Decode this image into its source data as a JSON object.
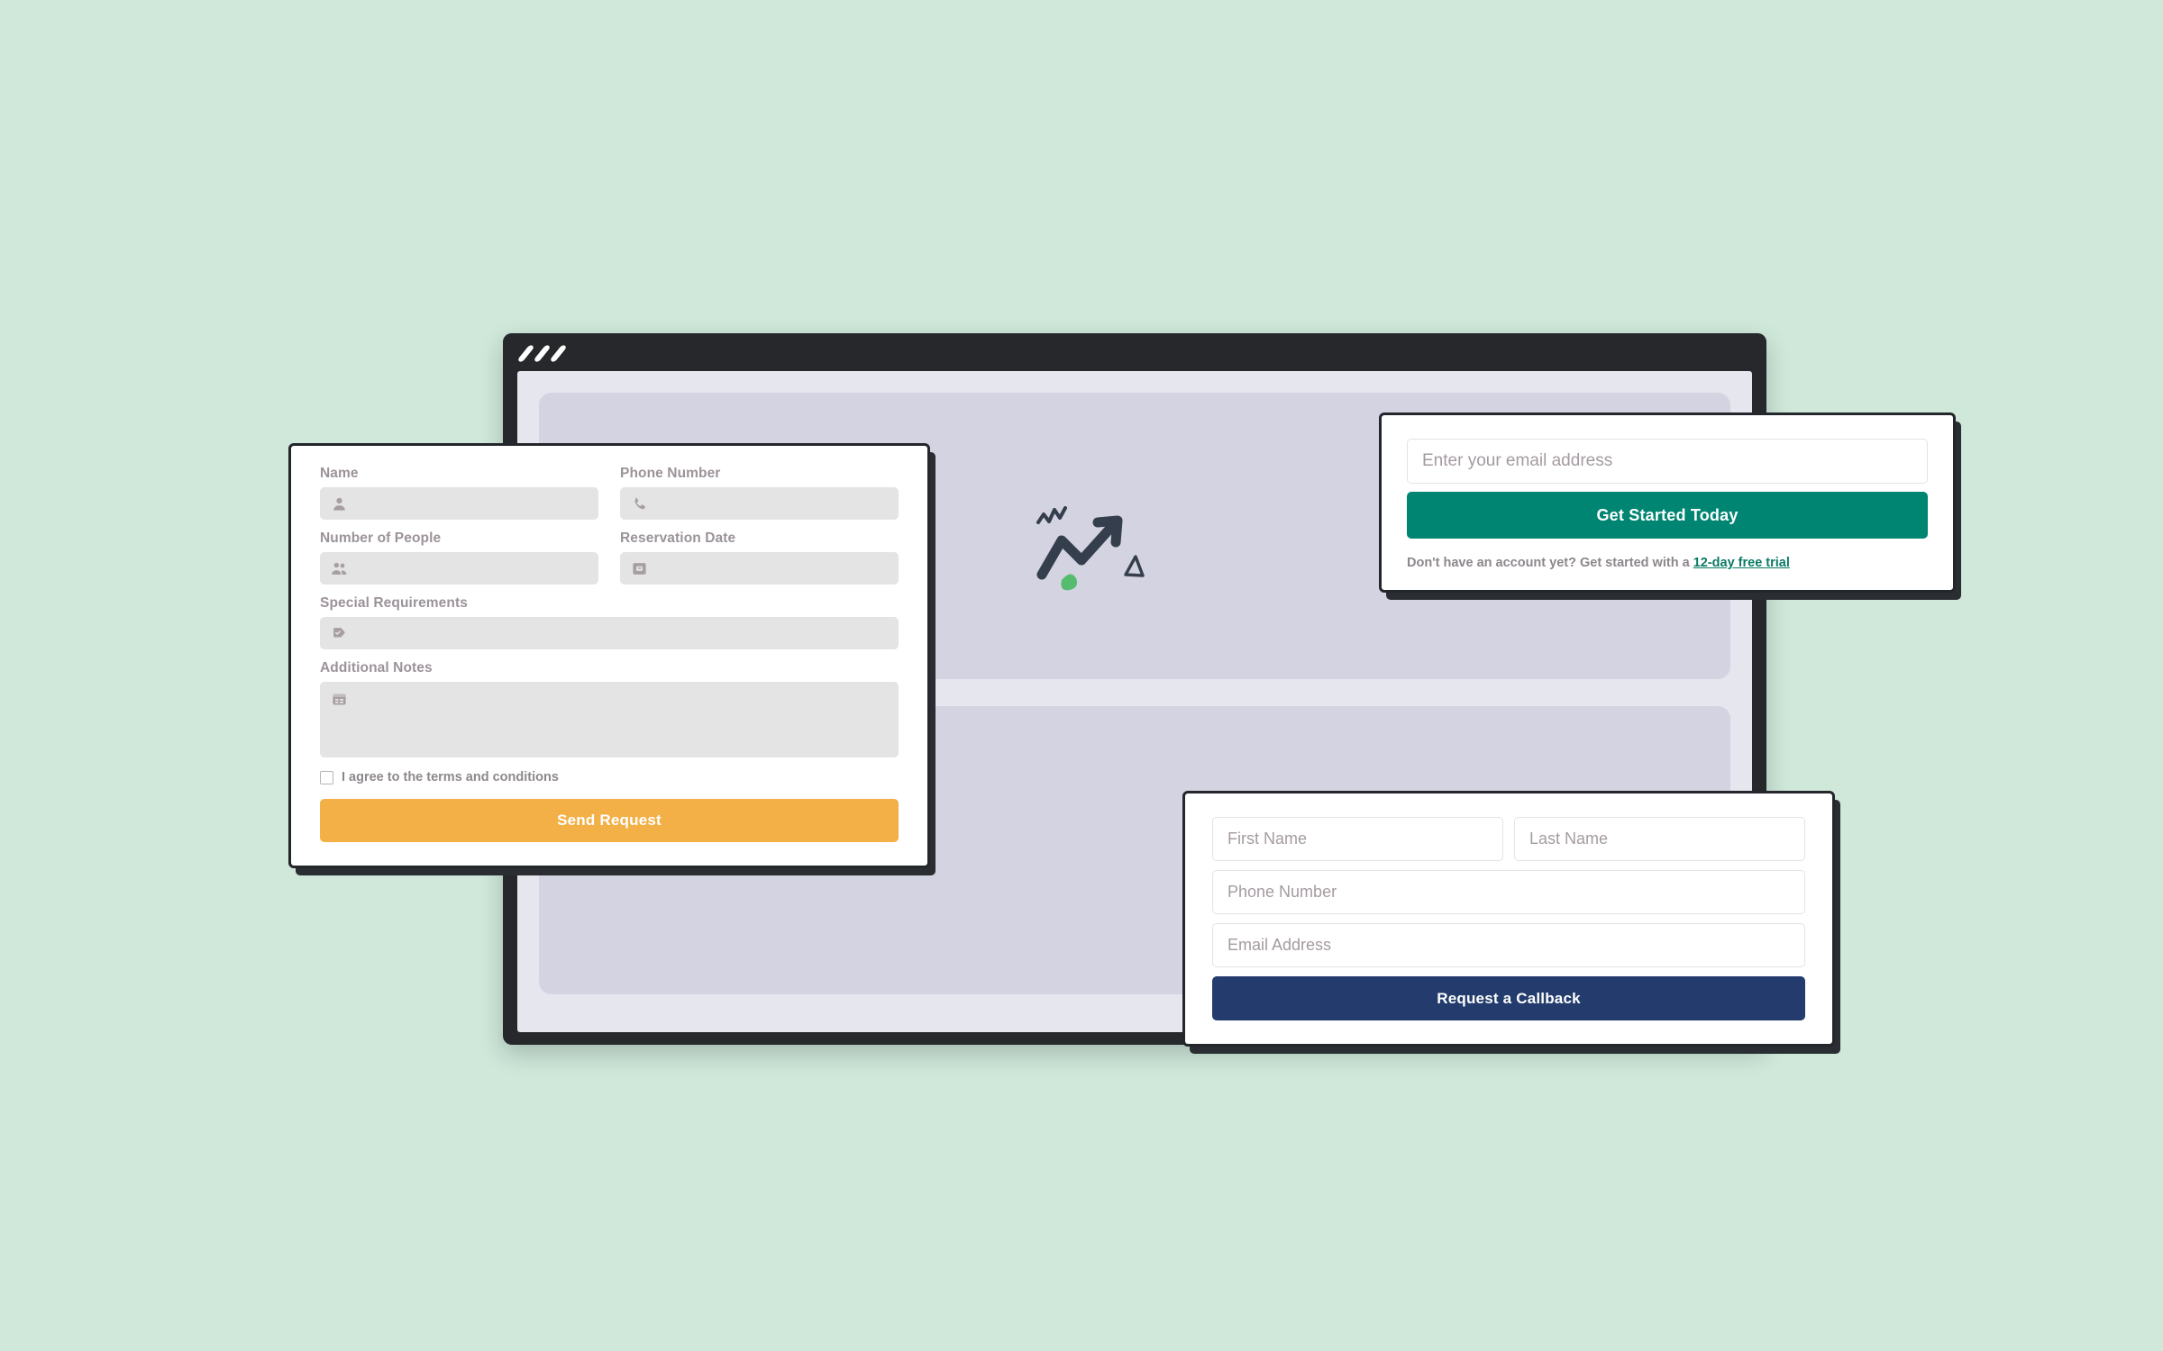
{
  "page": {
    "background_color": "#cfe8da"
  },
  "browser_window": {
    "title_bar_color": "#26282b",
    "body_color": "#e6e6ef",
    "panel_color": "#d3d3e1",
    "window_control_count": 3,
    "illustration": {
      "name": "growth-arrow-illustration",
      "arrow_color": "#343e4c",
      "accent_blob_color": "#55bb6e",
      "triangle_color": "#343e4c"
    }
  },
  "reservation_form": {
    "fields": [
      {
        "label": "Name",
        "icon": "person-icon",
        "value": "",
        "type": "text"
      },
      {
        "label": "Phone Number",
        "icon": "phone-icon",
        "value": "",
        "type": "tel"
      },
      {
        "label": "Number of People",
        "icon": "group-icon",
        "value": "",
        "type": "number"
      },
      {
        "label": "Reservation Date",
        "icon": "inbox-icon",
        "value": "",
        "type": "date"
      },
      {
        "label": "Special Requirements",
        "icon": "tag-check-icon",
        "value": "",
        "type": "text"
      },
      {
        "label": "Additional Notes",
        "icon": "calendar-card-icon",
        "value": "",
        "type": "textarea"
      }
    ],
    "terms_label": "I agree to the terms and conditions",
    "terms_checked": false,
    "submit_label": "Send Request",
    "submit_color": "#f2b046"
  },
  "email_capture": {
    "email_placeholder": "Enter your email address",
    "email_value": "",
    "submit_label": "Get Started Today",
    "submit_color": "#008573",
    "footer_prefix": "Don't have an account yet? Get started with a ",
    "footer_link": "12-day free trial",
    "footer_link_color": "#0b7a66"
  },
  "callback_form": {
    "first_name_placeholder": "First Name",
    "last_name_placeholder": "Last Name",
    "phone_placeholder": "Phone Number",
    "email_placeholder": "Email Address",
    "submit_label": "Request a Callback",
    "submit_color": "#233c6d"
  }
}
